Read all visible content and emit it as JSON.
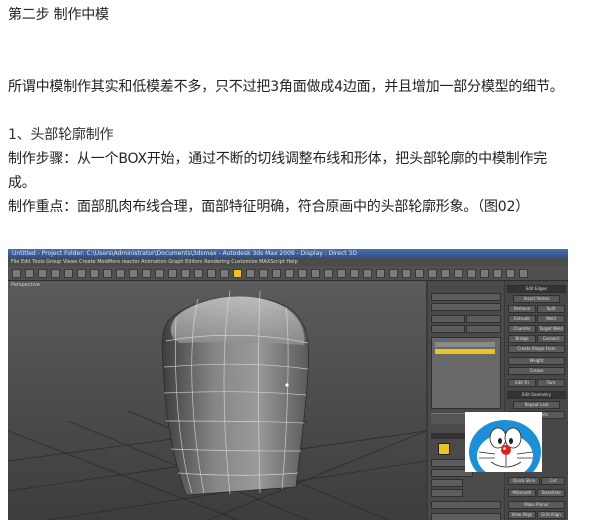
{
  "heading": "第二步 制作中模",
  "intro": "所谓中模制作其实和低模差不多，只不过把3角面做成4边面，并且增加一部分模型的细节。",
  "section": "1、头部轮廓制作",
  "steps_line1": "制作步骤：从一个BOX开始，通过不断的切线调整布线和形体，把头部轮廓的中模制作完",
  "steps_line2": "成。",
  "key_point": "制作重点：面部肌肉布线合理，面部特征明确，符合原画中的头部轮廓形象。（图02）",
  "screenshot": {
    "titlebar": "Untitled - Project Folder: C:\\Users\\Administrator\\Documents\\3dsmax - Autodesk 3ds Max 2009 - Display : Direct 3D",
    "menubar": "File  Edit  Tools  Group  Views  Create  Modifiers  reactor  Animation  Graph Editors  Rendering  Customize  MAXScript  Help",
    "viewport_label": "Perspective",
    "cmd_rollout": "Edit Edges",
    "cmd_rollout2": "Edit Geometry",
    "cmd_buttons": [
      "Insert Vertex",
      "Remove",
      "Split",
      "Extrude",
      "Weld",
      "Chamfer",
      "Target Weld",
      "Bridge",
      "Connect",
      "Create Shape From Selection",
      "Weight",
      "Crease",
      "Edit Tri",
      "Turn",
      "Repeat Last",
      "Constraints",
      "Quick Slice",
      "Cut",
      "MSmooth",
      "Tessellate",
      "Make Planar",
      "View Align",
      "Grid Align",
      "Relax"
    ],
    "side_labels": [
      "Box01",
      "Modifier List",
      "Symmetry",
      "TurboSmooth",
      "Unwrap UVW",
      "Shell",
      "Symmetry",
      "Editable Poly",
      "Selection",
      "By Vertex",
      "Ignore Backfacing",
      "Shrink",
      "Grow",
      "Ring",
      "Loop",
      "Preview Selection",
      "Off",
      "SubObj",
      "Multi",
      "0 Edges Selected",
      "Soft Selection"
    ],
    "colors": {
      "viewport": "#4a4a4a",
      "mesh": "#8a8a8a",
      "panel": "#4a4a4a",
      "highlight": "#e8c428"
    }
  }
}
